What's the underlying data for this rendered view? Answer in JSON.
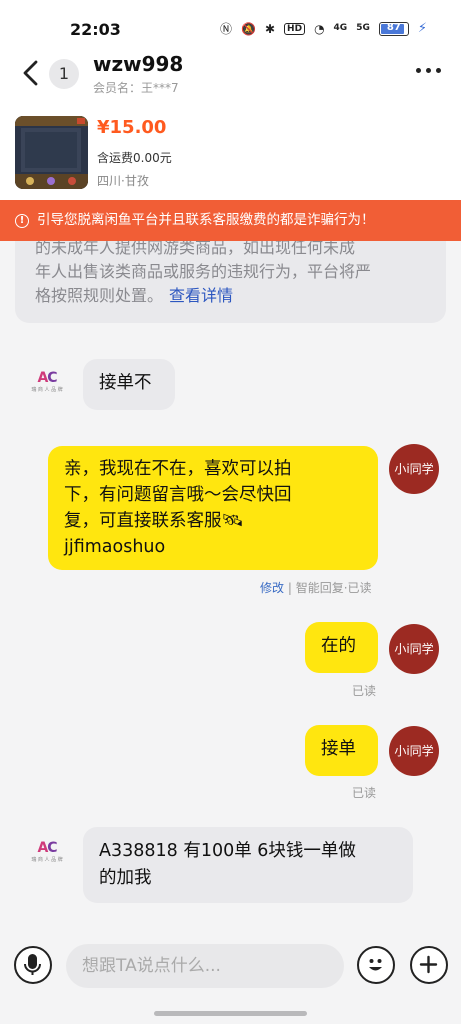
{
  "status_bar": {
    "time": "22:03",
    "hd": "HD",
    "net1": "4G",
    "net2": "5G",
    "battery": "87"
  },
  "header": {
    "unread_count": "1",
    "title": "wzw998",
    "subtitle": "会员名：王***7"
  },
  "product": {
    "price": "¥15.00",
    "shipping": "含运费0.00元",
    "location": "四川·甘孜"
  },
  "warning": {
    "text": "引导您脱离闲鱼平台并且联系客服缴费的都是诈骗行为！"
  },
  "notice": {
    "line1": "的未成年人提供网游类商品，如出现任何未成",
    "line2": "年人出售该类商品或服务的违规行为，平台将严",
    "line3": "格按照规则处置。",
    "link": "查看详情"
  },
  "messages": [
    {
      "side": "left",
      "text": "接单不"
    },
    {
      "side": "right",
      "text": "亲，我现在不在，喜欢可以拍下，有问题留言哦～会尽快回复，可直接联系客服🛰 jjfimaoshuo",
      "line1": "亲，我现在不在，喜欢可以拍",
      "line2": "下，有问题留言哦～会尽快回",
      "line3": "复，可直接联系客服🛰",
      "line4": "jjfimaoshuo",
      "meta_edit": "修改",
      "meta_rest": "| 智能回复·已读"
    },
    {
      "side": "right",
      "text": "在的",
      "meta": "已读"
    },
    {
      "side": "right",
      "text": "接单",
      "meta": "已读"
    },
    {
      "side": "left",
      "text": "A338818 有100单 6块钱一单做的加我",
      "line1": "A338818 有100单 6块钱一单做",
      "line2": "的加我"
    }
  ],
  "avatars": {
    "seller_logo": "AC",
    "seller_sub": "瑞 商 人 品 牌",
    "me": "小i同学"
  },
  "input": {
    "placeholder": "想跟TA说点什么..."
  },
  "colors": {
    "warning": "#f15e36",
    "price": "#ff5a1f",
    "my_bubble": "#ffe60f",
    "avatar": "#9c2a22"
  }
}
